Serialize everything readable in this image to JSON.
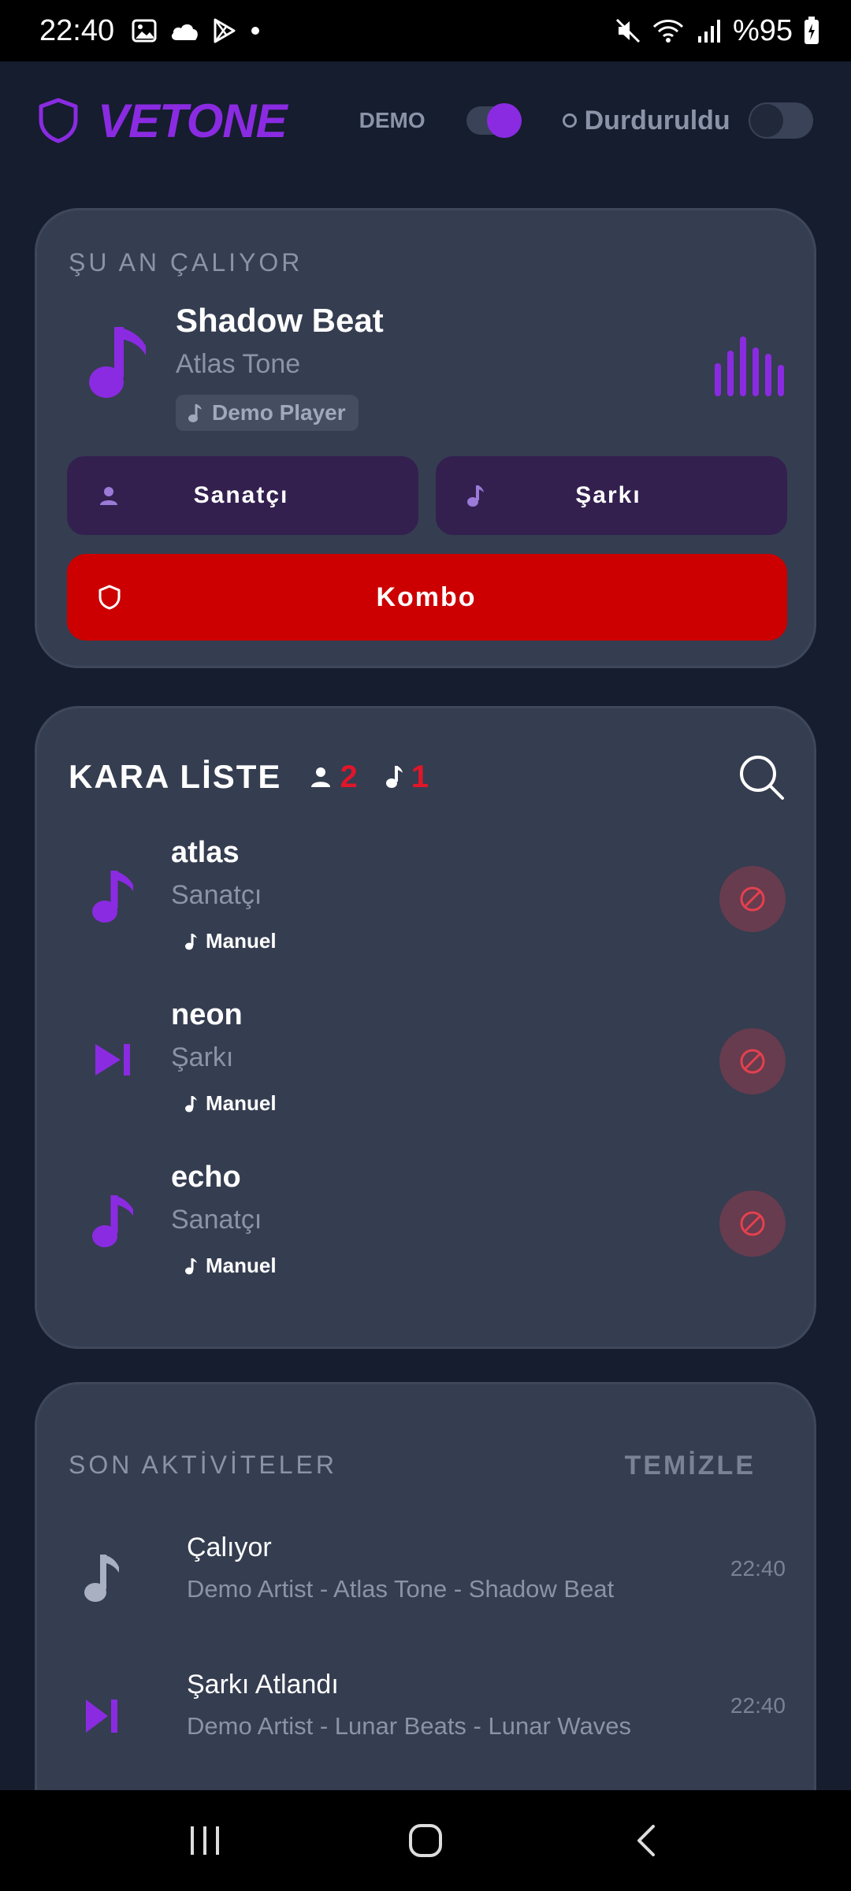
{
  "status_bar": {
    "time": "22:40",
    "battery": "%95",
    "icons": [
      "image-icon",
      "cloud-icon",
      "play-store-icon",
      "dot-icon",
      "mute-icon",
      "wifi-icon",
      "signal-icon",
      "battery-icon"
    ]
  },
  "header": {
    "brand": "VETONE",
    "demo_label": "DEMO",
    "demo_toggle_on": true,
    "status_text": "Durduruldu",
    "service_toggle_on": false,
    "accent_color": "#8a2be2"
  },
  "now_playing": {
    "section_label": "ŞU AN ÇALIYOR",
    "title": "Shadow Beat",
    "artist": "Atlas Tone",
    "source": "Demo Player",
    "buttons": {
      "artist": "Sanatçı",
      "song": "Şarkı",
      "combo": "Kombo"
    }
  },
  "blacklist": {
    "title": "KARA LİSTE",
    "artist_count": "2",
    "song_count": "1",
    "items": [
      {
        "name": "atlas",
        "type": "Sanatçı",
        "tag": "Manuel",
        "icon": "music-note-icon"
      },
      {
        "name": "neon",
        "type": "Şarkı",
        "tag": "Manuel",
        "icon": "skip-next-icon"
      },
      {
        "name": "echo",
        "type": "Sanatçı",
        "tag": "Manuel",
        "icon": "music-note-icon"
      }
    ]
  },
  "activity": {
    "section_label": "SON AKTİVİTELER",
    "clear_label": "TEMİZLE",
    "items": [
      {
        "title": "Çalıyor",
        "desc": "Demo Artist - Atlas Tone - Shadow Beat",
        "time": "22:40",
        "icon": "music-note-icon"
      },
      {
        "title": "Şarkı Atlandı",
        "desc": "Demo Artist - Lunar Beats - Lunar Waves",
        "time": "22:40",
        "icon": "skip-next-icon"
      }
    ]
  }
}
